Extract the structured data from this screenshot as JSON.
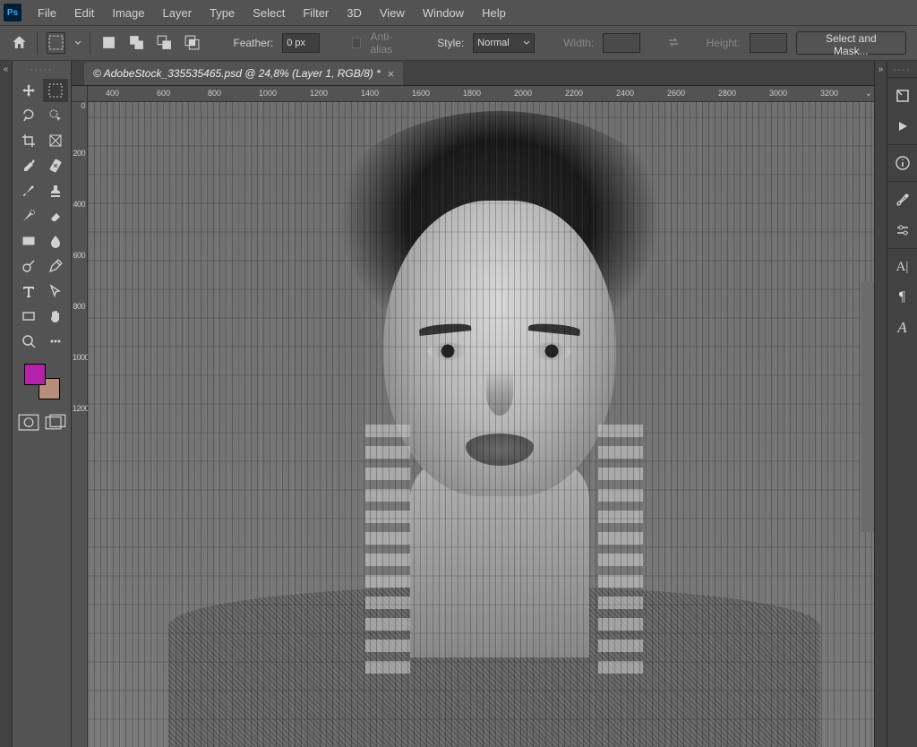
{
  "app": {
    "logo": "Ps"
  },
  "menu": [
    "File",
    "Edit",
    "Image",
    "Layer",
    "Type",
    "Select",
    "Filter",
    "3D",
    "View",
    "Window",
    "Help"
  ],
  "options": {
    "feather_label": "Feather:",
    "feather_value": "0 px",
    "antialias_label": "Anti-alias",
    "style_label": "Style:",
    "style_value": "Normal",
    "width_label": "Width:",
    "height_label": "Height:",
    "mask_button": "Select and Mask..."
  },
  "document": {
    "tab_title": "© AdobeStock_335535465.psd @ 24,8% (Layer 1, RGB/8) *",
    "close": "×"
  },
  "ruler": {
    "h": [
      "400",
      "600",
      "800",
      "1000",
      "1200",
      "1400",
      "1600",
      "1800",
      "2000",
      "2200",
      "2400",
      "2600",
      "2800",
      "3000",
      "3200"
    ],
    "v": [
      "0",
      "200",
      "400",
      "600",
      "800",
      "1000",
      "1200"
    ]
  },
  "colors": {
    "foreground": "#b322a8",
    "background": "#b68c7a"
  },
  "tools": {
    "left": [
      [
        "move",
        "marquee"
      ],
      [
        "lasso",
        "wand"
      ],
      [
        "crop",
        "slice"
      ],
      [
        "eyedropper",
        "healing"
      ],
      [
        "brush",
        "stamp"
      ],
      [
        "history-brush",
        "eraser"
      ],
      [
        "gradient",
        "blur"
      ],
      [
        "dodge",
        "pen"
      ],
      [
        "type",
        "path-select"
      ],
      [
        "rectangle",
        "hand"
      ],
      [
        "zoom",
        "more"
      ]
    ],
    "selected": "marquee"
  },
  "right_panels": [
    [
      "history",
      "play"
    ],
    [
      "info"
    ],
    [
      "brushes",
      "adjustments"
    ],
    [
      "character",
      "paragraph",
      "glyphs"
    ]
  ]
}
